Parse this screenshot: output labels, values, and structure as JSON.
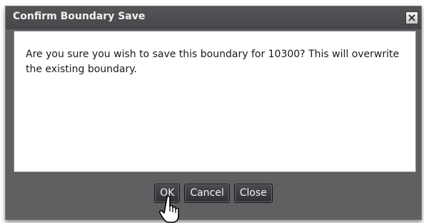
{
  "dialog": {
    "title": "Confirm Boundary Save",
    "close_symbol": "×",
    "message": "Are you sure you wish to save this boundary for 10300? This will overwrite the existing boundary.",
    "buttons": {
      "ok": "OK",
      "cancel": "Cancel",
      "close": "Close"
    }
  },
  "cursor": {
    "icon": "hand-pointer-icon"
  }
}
